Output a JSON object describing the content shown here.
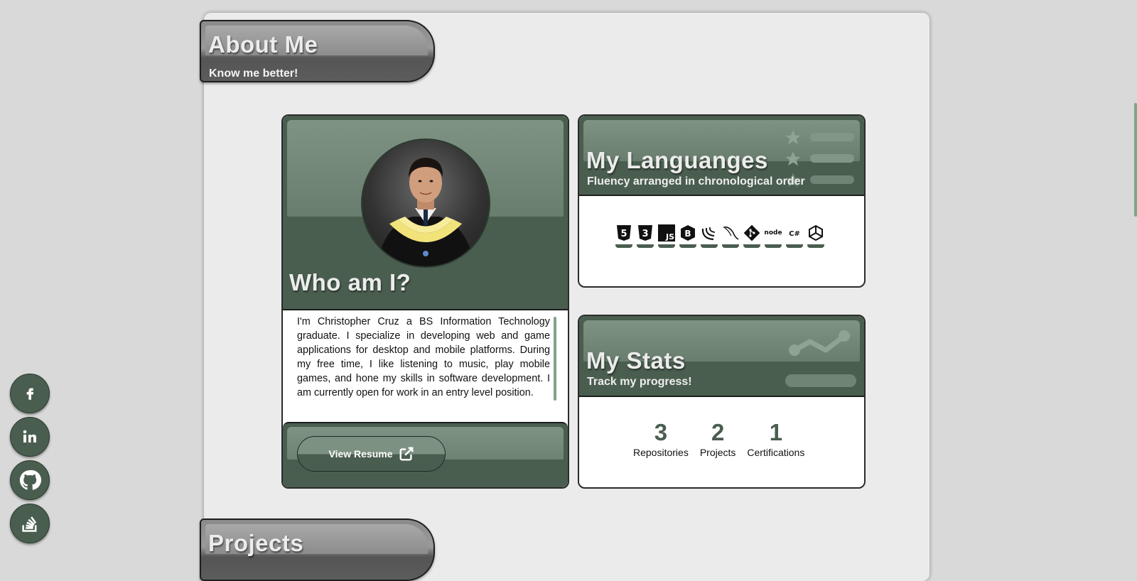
{
  "about_banner": {
    "title": "About Me",
    "subtitle": "Know me better!"
  },
  "who_card": {
    "title": "Who am I?",
    "bio": "I'm Christopher Cruz a BS Information Technology graduate. I specialize in developing web and game applications for desktop and mobile platforms. During my free time, I like listening to music, play mobile games, and hone my skills in software development. I am currently open for work in an entry level position.",
    "resume_label": "View Resume"
  },
  "languages_card": {
    "title": "My Languanges",
    "subtitle": "Fluency arranged in chronological order",
    "icons": [
      {
        "name": "html5-icon",
        "text": "5"
      },
      {
        "name": "css3-icon",
        "text": "3"
      },
      {
        "name": "javascript-icon",
        "text": "JS"
      },
      {
        "name": "bootstrap-icon",
        "text": "B"
      },
      {
        "name": "jquery-icon",
        "text": ""
      },
      {
        "name": "mysql-icon",
        "text": ""
      },
      {
        "name": "git-icon",
        "text": ""
      },
      {
        "name": "nodejs-icon",
        "text": "node"
      },
      {
        "name": "csharp-icon",
        "text": "C#"
      },
      {
        "name": "unity-icon",
        "text": ""
      }
    ]
  },
  "stats_card": {
    "title": "My Stats",
    "subtitle": "Track my progress!",
    "items": [
      {
        "value": "3",
        "label": "Repositories"
      },
      {
        "value": "2",
        "label": "Projects"
      },
      {
        "value": "1",
        "label": "Certifications"
      }
    ]
  },
  "projects_banner": {
    "title": "Projects"
  },
  "social": [
    "facebook-icon",
    "linkedin-icon",
    "github-icon",
    "stackoverflow-icon"
  ],
  "colors": {
    "accent": "#4a5e4f",
    "accent_light": "#7f9384",
    "scroll": "#7fa488"
  }
}
